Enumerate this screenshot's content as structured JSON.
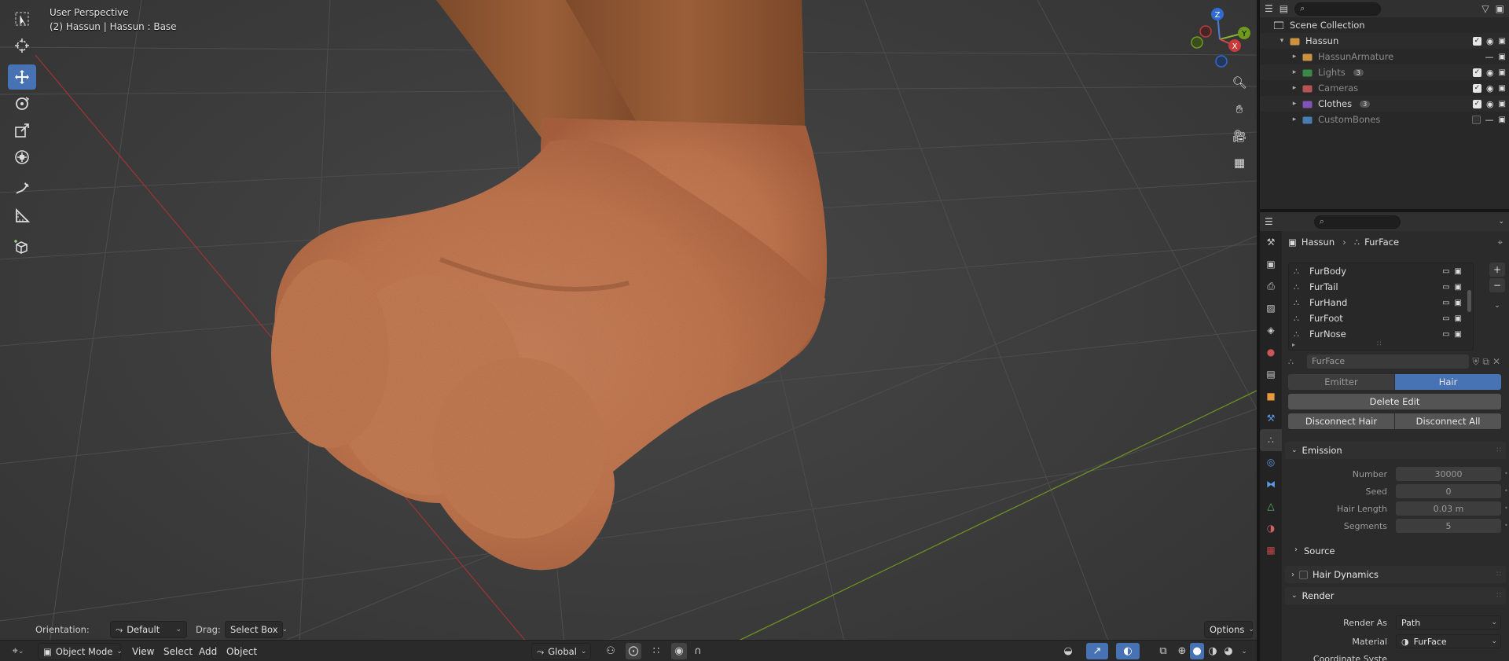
{
  "viewport": {
    "view_name": "User Perspective",
    "object_info": "(2) Hassun | Hassun : Base",
    "gizmo": {
      "x": "X",
      "y": "Y",
      "z": "Z"
    },
    "tool_settings": {
      "orientation_label": "Orientation:",
      "orientation_value": "Default",
      "drag_label": "Drag:",
      "drag_value": "Select Box",
      "options_label": "Options"
    },
    "header": {
      "mode": "Object Mode",
      "menus": [
        "View",
        "Select",
        "Add",
        "Object"
      ],
      "transform_orientation": "Global"
    },
    "tools": [
      "select-box",
      "cursor",
      "move",
      "rotate",
      "scale",
      "transform",
      "annotate",
      "measure",
      "add-cube"
    ],
    "active_tool": "move",
    "nav_buttons": [
      "zoom",
      "pan",
      "camera-view",
      "ortho-toggle"
    ],
    "axis_colors": {
      "x": "#b33f3f",
      "y": "#6f9a1e",
      "z": "#2f6bd0"
    }
  },
  "outliner": {
    "root": "Scene Collection",
    "items": [
      {
        "name": "Hassun",
        "color": "#e6a445",
        "expanded": true,
        "checked": true,
        "dim": false,
        "badge": ""
      },
      {
        "name": "HassunArmature",
        "color": "#e6a445",
        "expanded": false,
        "checked": null,
        "dim": true,
        "badge": ""
      },
      {
        "name": "Lights",
        "color": "#3d9a4c",
        "expanded": false,
        "checked": true,
        "dim": true,
        "badge": "3"
      },
      {
        "name": "Cameras",
        "color": "#d15b5b",
        "expanded": false,
        "checked": true,
        "dim": true,
        "badge": ""
      },
      {
        "name": "Clothes",
        "color": "#8e5bd1",
        "expanded": false,
        "checked": true,
        "dim": false,
        "badge": "3"
      },
      {
        "name": "CustomBones",
        "color": "#4f8cc9",
        "expanded": false,
        "checked": false,
        "dim": true,
        "badge": ""
      }
    ]
  },
  "properties": {
    "breadcrumb": {
      "object": "Hassun",
      "system": "FurFace"
    },
    "particle_systems": [
      "FurBody",
      "FurTail",
      "FurHand",
      "FurFoot",
      "FurNose"
    ],
    "settings_name": "FurFace",
    "type_tabs": [
      "Emitter",
      "Hair"
    ],
    "active_type": "Hair",
    "delete_edit": "Delete Edit",
    "disconnect_hair": "Disconnect Hair",
    "disconnect_all": "Disconnect All",
    "emission": {
      "title": "Emission",
      "fields": [
        {
          "label": "Number",
          "value": "30000"
        },
        {
          "label": "Seed",
          "value": "0"
        },
        {
          "label": "Hair Length",
          "value": "0.03 m"
        },
        {
          "label": "Segments",
          "value": "5"
        }
      ],
      "source": "Source"
    },
    "hair_dynamics": "Hair Dynamics",
    "render": {
      "title": "Render",
      "render_as_label": "Render As",
      "render_as_value": "Path",
      "material_label": "Material",
      "material_value": "FurFace",
      "coord_label": "Coordinate Syste"
    }
  }
}
